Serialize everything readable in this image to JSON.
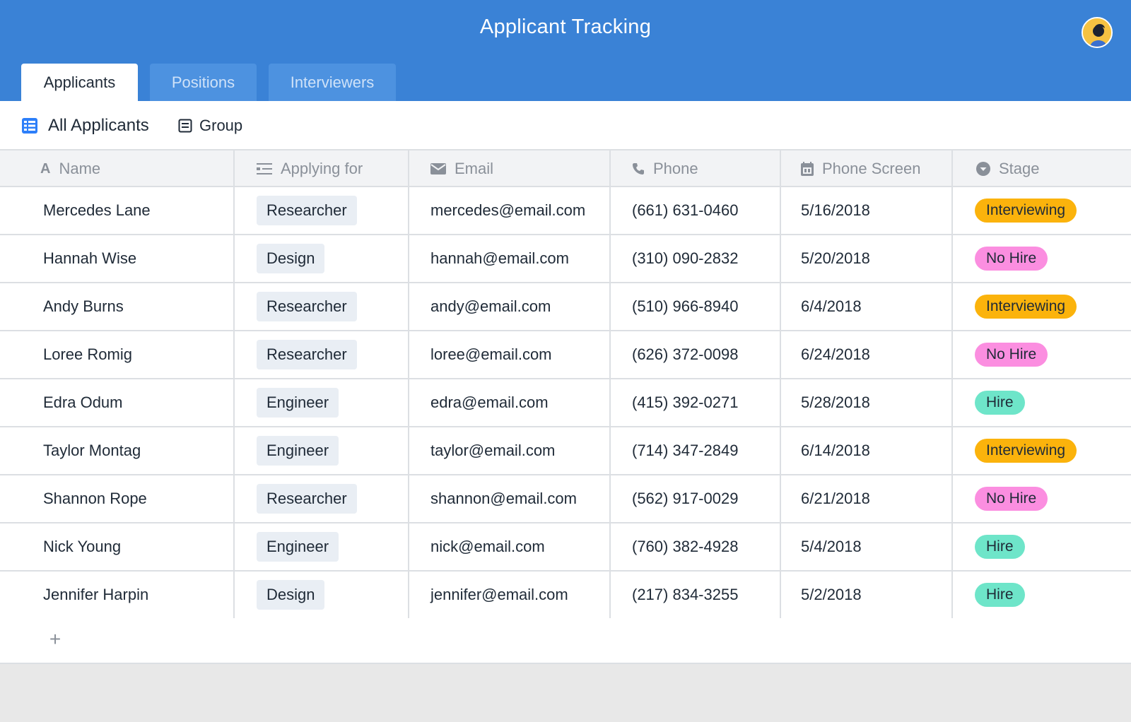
{
  "app": {
    "title": "Applicant Tracking"
  },
  "tabs": [
    {
      "label": "Applicants",
      "active": true
    },
    {
      "label": "Positions",
      "active": false
    },
    {
      "label": "Interviewers",
      "active": false
    }
  ],
  "toolbar": {
    "view_name": "All Applicants",
    "view_icon": "grid-view-icon",
    "group_label": "Group",
    "group_icon": "group-icon"
  },
  "columns": [
    {
      "label": "Name",
      "icon": "text-field-icon"
    },
    {
      "label": "Applying for",
      "icon": "multiple-select-icon"
    },
    {
      "label": "Email",
      "icon": "email-icon"
    },
    {
      "label": "Phone",
      "icon": "phone-icon"
    },
    {
      "label": "Phone Screen",
      "icon": "calendar-icon"
    },
    {
      "label": "Stage",
      "icon": "single-select-icon"
    }
  ],
  "colors": {
    "header": "#3a82d6",
    "interviewing": "#fbb30c",
    "no_hire": "#fb8ee0",
    "hire": "#6ee5c9"
  },
  "rows": [
    {
      "name": "Mercedes Lane",
      "applying_for": "Researcher",
      "email": "mercedes@email.com",
      "phone": "(661) 631-0460",
      "phone_screen": "5/16/2018",
      "stage": "Interviewing"
    },
    {
      "name": "Hannah Wise",
      "applying_for": "Design",
      "email": "hannah@email.com",
      "phone": "(310) 090-2832",
      "phone_screen": "5/20/2018",
      "stage": "No Hire"
    },
    {
      "name": "Andy Burns",
      "applying_for": "Researcher",
      "email": "andy@email.com",
      "phone": "(510) 966-8940",
      "phone_screen": "6/4/2018",
      "stage": "Interviewing"
    },
    {
      "name": "Loree Romig",
      "applying_for": "Researcher",
      "email": "loree@email.com",
      "phone": "(626) 372-0098",
      "phone_screen": "6/24/2018",
      "stage": "No Hire"
    },
    {
      "name": "Edra Odum",
      "applying_for": "Engineer",
      "email": "edra@email.com",
      "phone": "(415) 392-0271",
      "phone_screen": "5/28/2018",
      "stage": "Hire"
    },
    {
      "name": "Taylor Montag",
      "applying_for": "Engineer",
      "email": "taylor@email.com",
      "phone": "(714) 347-2849",
      "phone_screen": "6/14/2018",
      "stage": "Interviewing"
    },
    {
      "name": "Shannon Rope",
      "applying_for": "Researcher",
      "email": "shannon@email.com",
      "phone": "(562) 917-0029",
      "phone_screen": "6/21/2018",
      "stage": "No Hire"
    },
    {
      "name": "Nick Young",
      "applying_for": "Engineer",
      "email": "nick@email.com",
      "phone": "(760) 382-4928",
      "phone_screen": "5/4/2018",
      "stage": "Hire"
    },
    {
      "name": "Jennifer Harpin",
      "applying_for": "Design",
      "email": "jennifer@email.com",
      "phone": "(217) 834-3255",
      "phone_screen": "5/2/2018",
      "stage": "Hire"
    }
  ],
  "add_row": {
    "icon": "plus-icon",
    "label": "+"
  }
}
